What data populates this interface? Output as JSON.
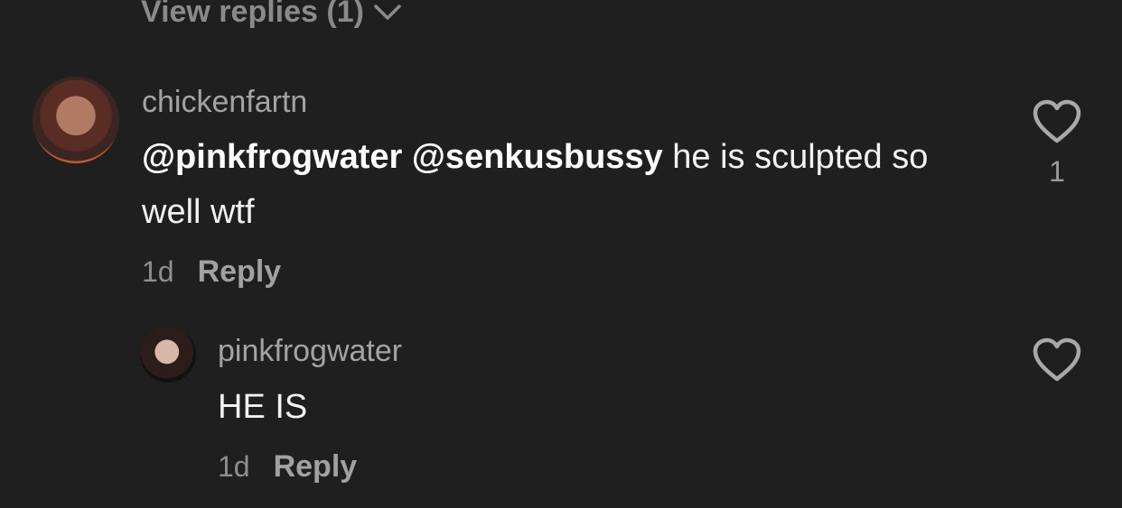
{
  "view_replies": {
    "label": "View replies (1)",
    "icon": "chevron-down-icon"
  },
  "comments": [
    {
      "username": "chickenfartn",
      "mentions": [
        "@pinkfrogwater",
        "@senkusbussy"
      ],
      "text": "he is sculpted so well wtf",
      "time": "1d",
      "reply_label": "Reply",
      "like_count": "1",
      "like_icon": "heart-outline-icon"
    },
    {
      "username": "pinkfrogwater",
      "text": "HE IS",
      "time": "1d",
      "reply_label": "Reply",
      "like_icon": "heart-outline-icon"
    }
  ]
}
